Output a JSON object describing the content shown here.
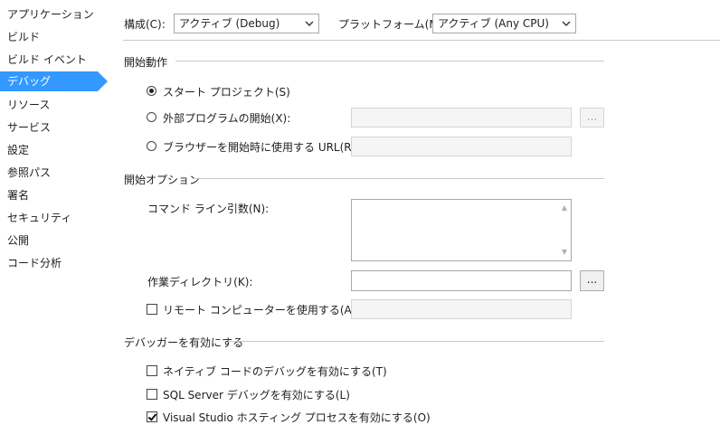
{
  "sidebar": {
    "items": [
      {
        "label": "アプリケーション"
      },
      {
        "label": "ビルド"
      },
      {
        "label": "ビルド イベント"
      },
      {
        "label": "デバッグ"
      },
      {
        "label": "リソース"
      },
      {
        "label": "サービス"
      },
      {
        "label": "設定"
      },
      {
        "label": "参照パス"
      },
      {
        "label": "署名"
      },
      {
        "label": "セキュリティ"
      },
      {
        "label": "公開"
      },
      {
        "label": "コード分析"
      }
    ],
    "selected_index": 3,
    "selected_color": "#3399ff"
  },
  "config": {
    "configuration_label": "構成(C):",
    "configuration_value": "アクティブ (Debug)",
    "platform_label": "プラットフォーム(M):",
    "platform_value": "アクティブ (Any CPU)"
  },
  "start_action": {
    "title": "開始動作",
    "start_project_label": "スタート プロジェクト(S)",
    "external_program_label": "外部プログラムの開始(X):",
    "browse_button_label": "...",
    "browser_url_label": "ブラウザーを開始時に使用する URL(R):",
    "selected": "start_project"
  },
  "start_options": {
    "title": "開始オプション",
    "command_args_label": "コマンド ライン引数(N):",
    "command_args_value": "",
    "working_dir_label": "作業ディレクトリ(K):",
    "working_dir_value": "",
    "working_dir_browse_label": "...",
    "remote_machine_label": "リモート コンピューターを使用する(A)",
    "remote_machine_checked": false
  },
  "debuggers": {
    "title": "デバッガーを有効にする",
    "native_label": "ネイティブ コードのデバッグを有効にする(T)",
    "native_checked": false,
    "sql_label": "SQL Server デバッグを有効にする(L)",
    "sql_checked": false,
    "vshost_label": "Visual Studio ホスティング プロセスを有効にする(O)",
    "vshost_checked": true
  }
}
